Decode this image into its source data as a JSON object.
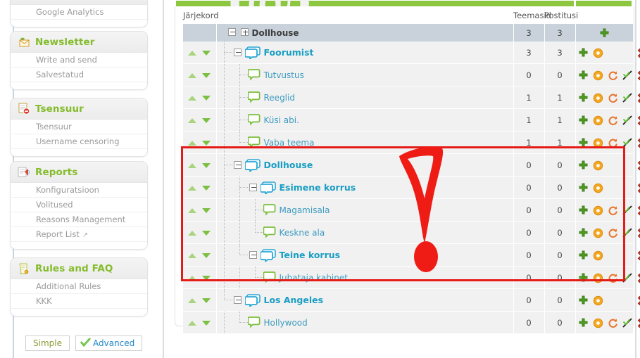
{
  "sidebar": {
    "panels": [
      {
        "title": "",
        "icon": "chart-icon",
        "items": [
          {
            "label": "Google Analytics",
            "external": false
          }
        ]
      },
      {
        "title": "Newsletter",
        "icon": "envelope-icon",
        "items": [
          {
            "label": "Write and send",
            "external": false
          },
          {
            "label": "Salvestatud",
            "external": false
          }
        ]
      },
      {
        "title": "Tsensuur",
        "icon": "censor-icon",
        "items": [
          {
            "label": "Tsensuur",
            "external": false
          },
          {
            "label": "Username censoring",
            "external": false
          }
        ]
      },
      {
        "title": "Reports",
        "icon": "report-icon",
        "items": [
          {
            "label": "Konfiguratsioon",
            "external": false
          },
          {
            "label": "Volitused",
            "external": false
          },
          {
            "label": "Reasons Management",
            "external": false
          },
          {
            "label": "Report List",
            "external": true
          }
        ]
      },
      {
        "title": "Rules and FAQ",
        "icon": "scroll-icon",
        "items": [
          {
            "label": "Additional Rules",
            "external": false
          },
          {
            "label": "KKK",
            "external": false
          }
        ]
      }
    ],
    "mode_buttons": {
      "simple": "Simple",
      "advanced": "Advanced"
    }
  },
  "main": {
    "columns": {
      "sort": "Järjekord",
      "name": "",
      "topics": "Teemasid",
      "posts": "Postitusi",
      "actions": ""
    },
    "root": {
      "label": "Dollhouse",
      "topics": "3",
      "posts": "3",
      "actions": [
        "add-icon"
      ]
    },
    "rows": [
      {
        "label": "Foorumist",
        "type": "category",
        "depth": 0,
        "toggle": "minus",
        "guides": [
          "t"
        ],
        "topics": "3",
        "posts": "3",
        "actions": [
          "add-icon",
          "settings-icon",
          "spacer",
          "spacer",
          "delete-icon"
        ],
        "highlight": false
      },
      {
        "label": "Tutvustus",
        "type": "forum",
        "depth": 1,
        "toggle": "none",
        "guides": [
          "v",
          "t"
        ],
        "topics": "0",
        "posts": "0",
        "actions": [
          "add-icon",
          "settings-icon",
          "sync-icon",
          "permissions-icon",
          "delete-icon"
        ],
        "highlight": false
      },
      {
        "label": "Reeglid",
        "type": "forum",
        "depth": 1,
        "toggle": "none",
        "guides": [
          "v",
          "t"
        ],
        "topics": "1",
        "posts": "1",
        "actions": [
          "add-icon",
          "settings-icon",
          "sync-icon",
          "permissions-icon",
          "delete-icon"
        ],
        "highlight": false
      },
      {
        "label": "Küsi abi.",
        "type": "forum",
        "depth": 1,
        "toggle": "none",
        "guides": [
          "v",
          "t"
        ],
        "topics": "1",
        "posts": "1",
        "actions": [
          "add-icon",
          "settings-icon",
          "sync-icon",
          "permissions-icon",
          "delete-icon"
        ],
        "highlight": false
      },
      {
        "label": "Vaba teema",
        "type": "forum",
        "depth": 1,
        "toggle": "none",
        "guides": [
          "v",
          "l"
        ],
        "topics": "1",
        "posts": "1",
        "actions": [
          "add-icon",
          "settings-icon",
          "sync-icon",
          "permissions-icon",
          "delete-icon"
        ],
        "highlight": false
      },
      {
        "label": "Dollhouse",
        "type": "category",
        "depth": 0,
        "toggle": "minus",
        "guides": [
          "t"
        ],
        "topics": "0",
        "posts": "0",
        "actions": [
          "add-icon",
          "settings-icon",
          "spacer",
          "spacer",
          "delete-icon"
        ],
        "highlight": true
      },
      {
        "label": "Esimene korrus",
        "type": "category",
        "depth": 1,
        "toggle": "minus",
        "guides": [
          "v",
          "t"
        ],
        "topics": "0",
        "posts": "0",
        "actions": [
          "add-icon",
          "settings-icon",
          "spacer",
          "spacer",
          "delete-icon"
        ],
        "highlight": true
      },
      {
        "label": "Magamisala",
        "type": "forum",
        "depth": 2,
        "toggle": "none",
        "guides": [
          "v",
          "v",
          "t"
        ],
        "topics": "0",
        "posts": "0",
        "actions": [
          "add-icon",
          "settings-icon",
          "sync-icon",
          "permissions-icon",
          "delete-icon"
        ],
        "highlight": true
      },
      {
        "label": "Keskne ala",
        "type": "forum",
        "depth": 2,
        "toggle": "none",
        "guides": [
          "v",
          "v",
          "l"
        ],
        "topics": "0",
        "posts": "0",
        "actions": [
          "add-icon",
          "settings-icon",
          "sync-icon",
          "permissions-icon",
          "delete-icon"
        ],
        "highlight": true
      },
      {
        "label": "Teine korrus",
        "type": "category",
        "depth": 1,
        "toggle": "minus",
        "guides": [
          "v",
          "l"
        ],
        "topics": "0",
        "posts": "0",
        "actions": [
          "add-icon",
          "settings-icon",
          "spacer",
          "spacer",
          "delete-icon"
        ],
        "highlight": true
      },
      {
        "label": "Juhataja kabinet",
        "type": "forum",
        "depth": 2,
        "toggle": "none",
        "guides": [
          "v",
          "v",
          "l"
        ],
        "topics": "0",
        "posts": "0",
        "actions": [
          "add-icon",
          "settings-icon",
          "sync-icon",
          "permissions-icon",
          "delete-icon"
        ],
        "highlight": true
      },
      {
        "label": "Los Angeles",
        "type": "category",
        "depth": 0,
        "toggle": "minus",
        "guides": [
          "l"
        ],
        "topics": "0",
        "posts": "0",
        "actions": [
          "add-icon",
          "settings-icon",
          "spacer",
          "spacer",
          "delete-icon"
        ],
        "highlight": false
      },
      {
        "label": "Hollywood",
        "type": "forum",
        "depth": 1,
        "toggle": "none",
        "guides": [
          "v",
          "l"
        ],
        "topics": "0",
        "posts": "0",
        "actions": [
          "add-icon",
          "settings-icon",
          "sync-icon",
          "permissions-icon",
          "delete-icon"
        ],
        "highlight": false
      }
    ]
  },
  "annotation": {
    "shape": "red-rectangle-and-arrow",
    "color": "#e41b17"
  },
  "colors": {
    "accent_green": "#8dc63f",
    "category_blue": "#1a9ec4",
    "forum_blue": "#3d9bbf",
    "panel_title": "#84bc2b",
    "root_row_bg": "#c9d2da",
    "row_bg": "#f1f1f1",
    "annotation_red": "#e41b17"
  }
}
